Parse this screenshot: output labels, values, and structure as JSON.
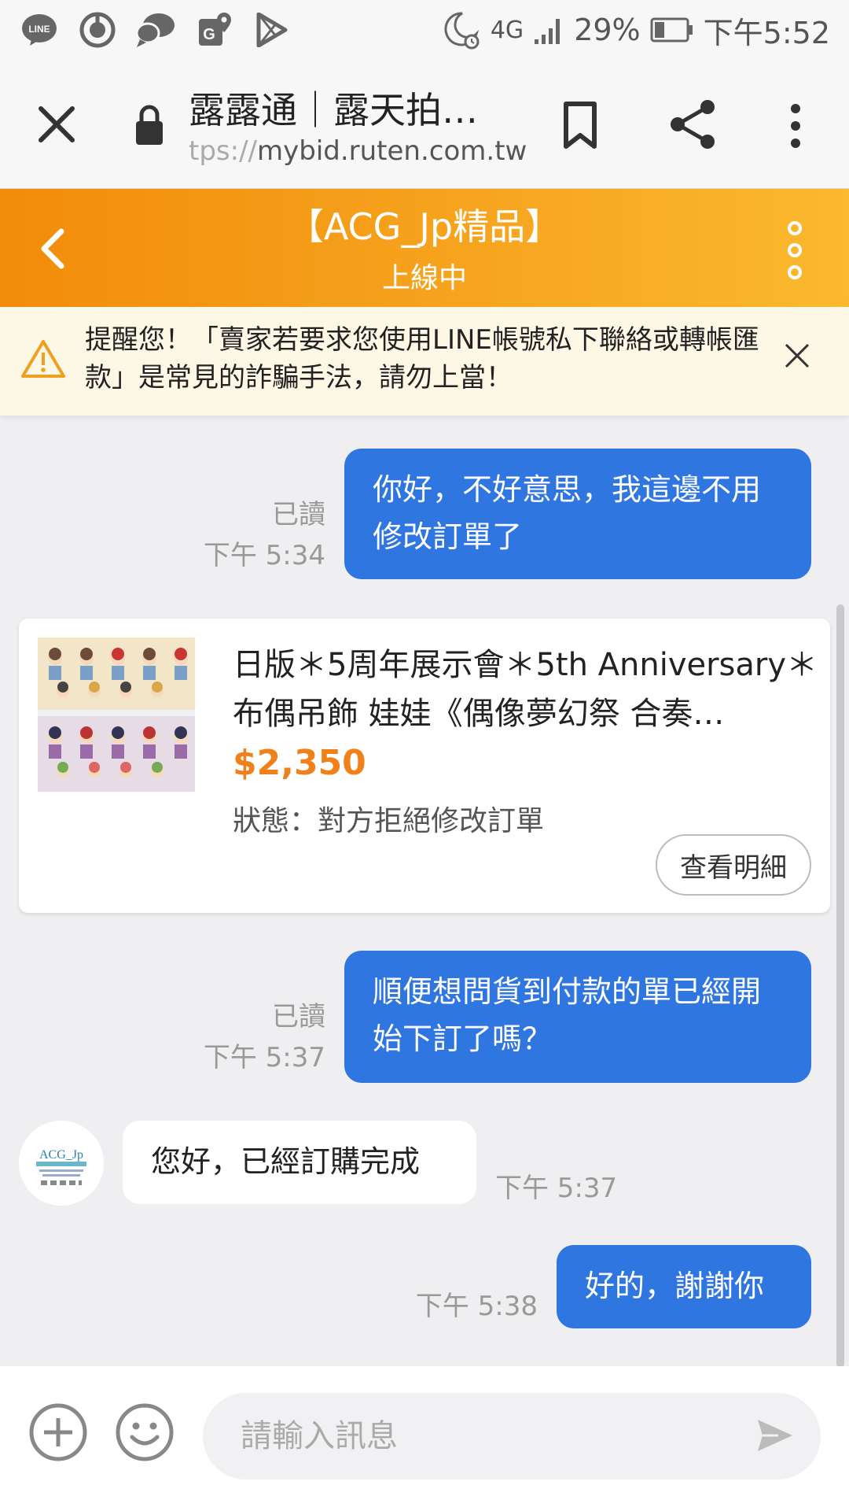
{
  "status_bar": {
    "network": "4G",
    "battery": "29%",
    "time": "下午5:52"
  },
  "browser": {
    "page_title": "露露通｜露天拍…",
    "url_prefix": "tps://",
    "url_host": "mybid.ruten.com.tw"
  },
  "chat_header": {
    "title": "【ACG_Jp精品】",
    "status": "上線中"
  },
  "warning": {
    "text": "提醒您！「賣家若要求您使用LINE帳號私下聯絡或轉帳匯款」是常見的詐騙手法，請勿上當！"
  },
  "messages": [
    {
      "direction": "out",
      "text": "你好，不好意思，我這邊不用修改訂單了",
      "read": "已讀",
      "time": "下午 5:34"
    },
    {
      "direction": "out",
      "text": "順便想問貨到付款的單已經開始下訂了嗎？",
      "read": "已讀",
      "time": "下午 5:37"
    },
    {
      "direction": "in",
      "text": "您好，已經訂購完成",
      "time": "下午 5:37"
    },
    {
      "direction": "out",
      "text": "好的，謝謝你",
      "time": "下午 5:38"
    }
  ],
  "product": {
    "title": "日版＊5周年展示會＊5th Anniversary＊布偶吊飾 娃娃《偶像夢幻祭 合奏…",
    "price": "$2,350",
    "status": "狀態：對方拒絕修改訂單",
    "detail_button": "查看明細"
  },
  "seller_avatar": {
    "logo_text": "ACG_Jp"
  },
  "input": {
    "placeholder": "請輸入訊息"
  },
  "colors": {
    "accent_orange": "#f7a620",
    "bubble_blue": "#2f76e0",
    "price_orange": "#f0801a"
  },
  "icons": [
    "line-icon",
    "sync-icon",
    "chat-icon",
    "maps-icon",
    "play-store-icon",
    "moon-alarm-icon",
    "signal-icon",
    "battery-icon",
    "close-icon",
    "lock-icon",
    "bookmark-icon",
    "share-icon",
    "more-vertical-icon",
    "back-icon",
    "warning-icon",
    "plus-icon",
    "emoji-icon",
    "send-icon"
  ]
}
